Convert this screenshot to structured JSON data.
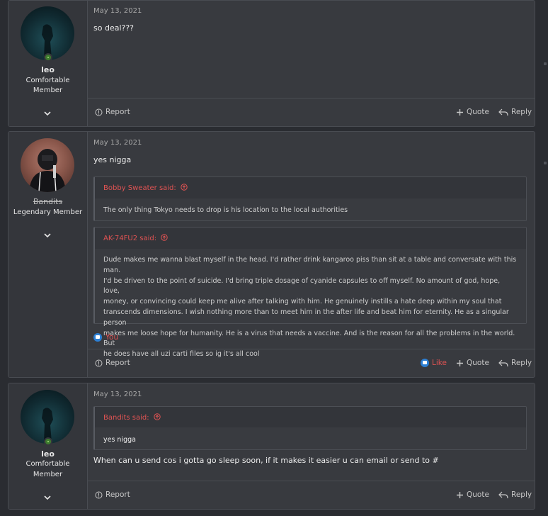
{
  "posts": [
    {
      "username": "leo",
      "user_title": "Comfortable Member",
      "user_title_line1": "Comfortable",
      "user_title_line2": "Member",
      "date": "May 13, 2021",
      "message": "so deal???",
      "actions": {
        "report": "Report",
        "quote": "Quote",
        "reply": "Reply"
      }
    },
    {
      "username": "Bandits",
      "user_title": "Legendary Member",
      "date": "May 13, 2021",
      "message": "yes nigga",
      "quotes": [
        {
          "author_line": "Bobby Sweater said:",
          "text": "The only thing Tokyo needs to drop is his location to the local authorities"
        },
        {
          "author_line": "AK-74FU2 said:",
          "lines": [
            "Dude makes me wanna blast myself in the head. I'd rather drink kangaroo piss than sit at a table and conversate with this man.",
            "I'd be driven to the point of suicide. I'd bring triple dosage of cyanide capsules to off myself. No amount of god, hope, love,",
            "money, or convincing could keep me alive after talking with him. He genuinely instills a hate deep within my soul that",
            "transcends dimensions. I wish nothing more than to meet him in the after life and beat him for eternity. He as a singular person",
            "makes me loose hope for humanity. He is a virus that needs a vaccine. And is the reason for all the problems in the world. But",
            "he does have all uzi carti files so ig it's all cool"
          ]
        }
      ],
      "reaction": "You",
      "actions": {
        "report": "Report",
        "like": "Like",
        "quote": "Quote",
        "reply": "Reply"
      }
    },
    {
      "username": "leo",
      "user_title_line1": "Comfortable",
      "user_title_line2": "Member",
      "date": "May 13, 2021",
      "quotes": [
        {
          "author_line": "Bandits said:",
          "text": "yes nigga"
        }
      ],
      "message": "When can u send cos i gotta go sleep soon, if it makes it easier u can email or send to #",
      "actions": {
        "report": "Report",
        "quote": "Quote",
        "reply": "Reply"
      }
    }
  ],
  "colors": {
    "accent_red": "#e05353",
    "online_green": "#3d7a2e",
    "like_blue": "#2c7fd4"
  }
}
